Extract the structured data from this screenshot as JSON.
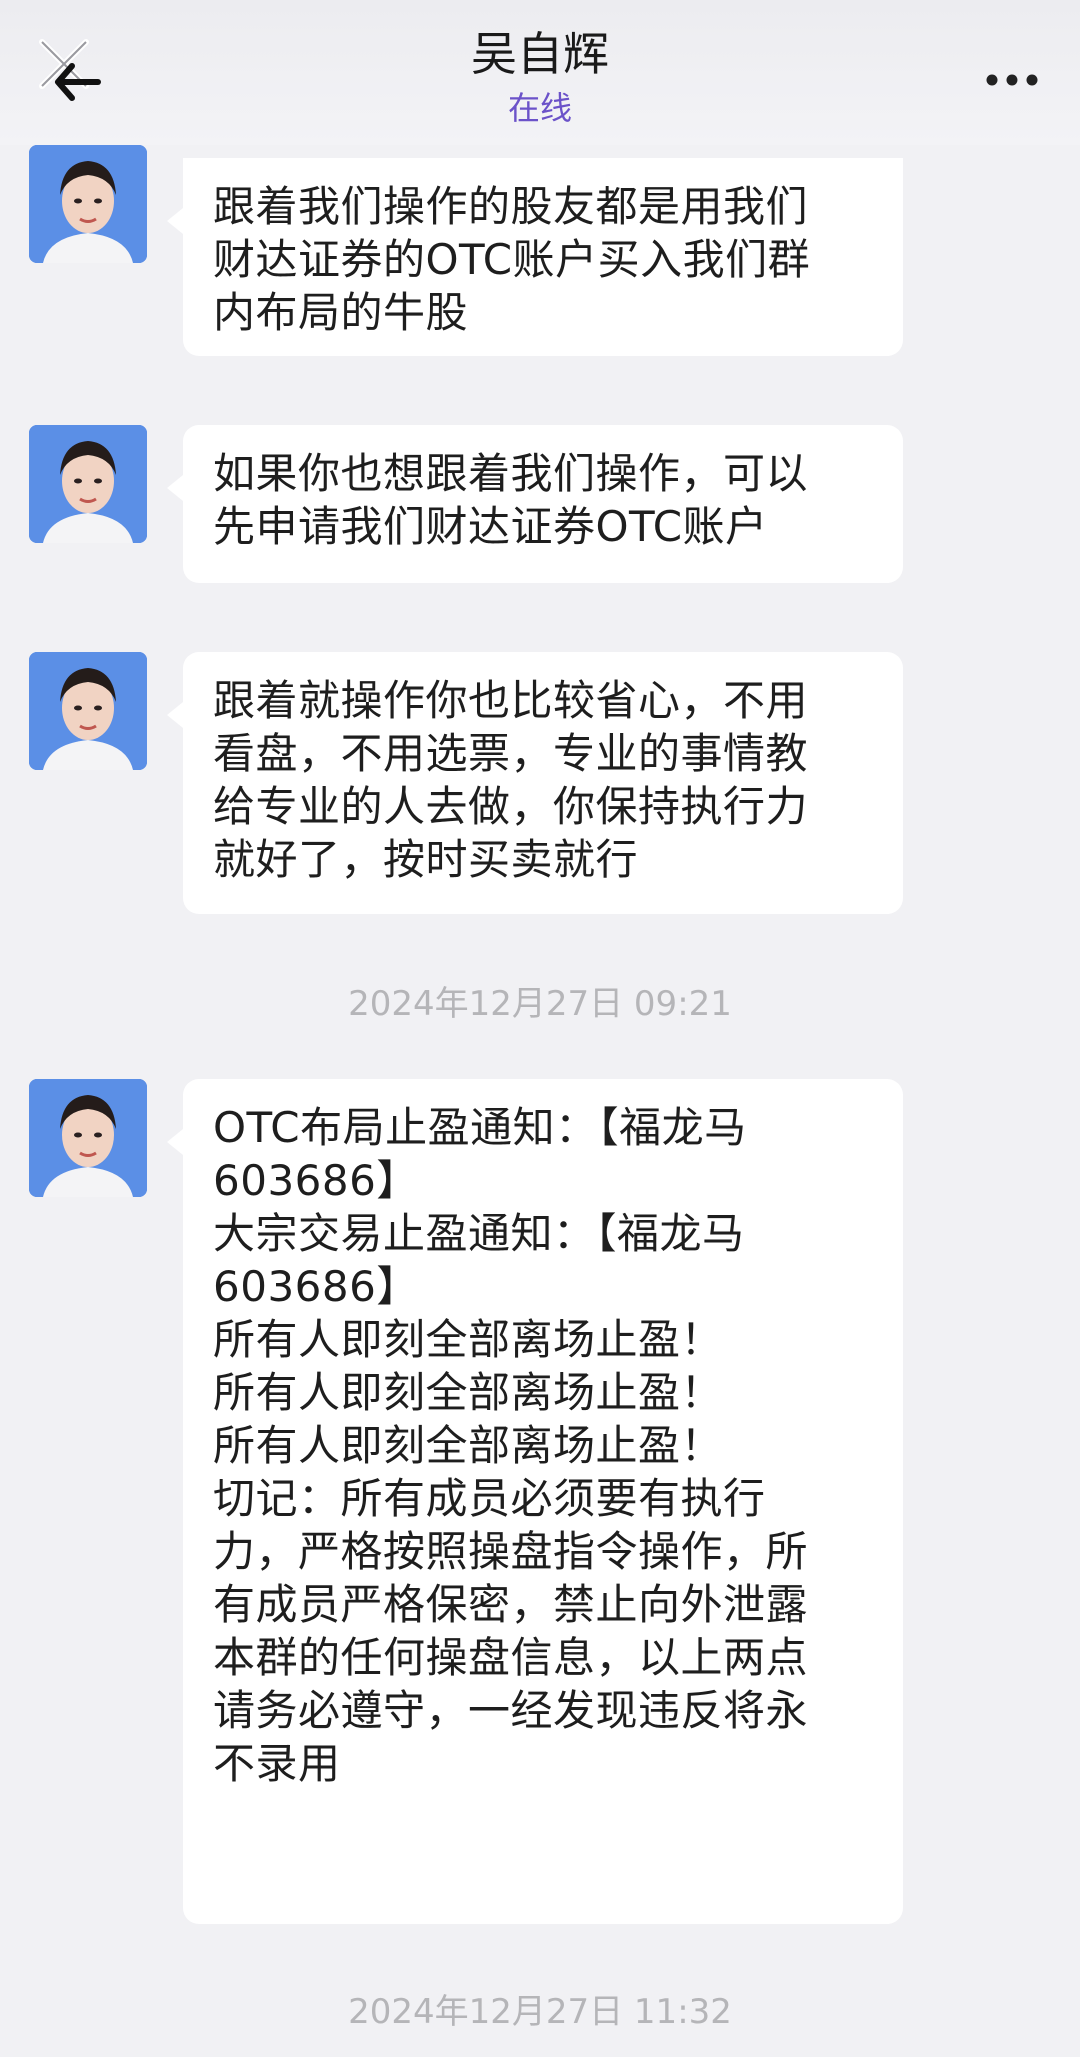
{
  "header": {
    "title": "吴自辉",
    "status": "在线"
  },
  "messages": [
    {
      "lines": [
        "跟着我们操作的股友都是用我们",
        "财达证券的OTC账户买入我们群",
        "内布局的牛股"
      ]
    },
    {
      "lines": [
        "如果你也想跟着我们操作，可以",
        "先申请我们财达证券OTC账户"
      ]
    },
    {
      "lines": [
        "跟着就操作你也比较省心，不用",
        "看盘，不用选票，专业的事情教",
        "给专业的人去做，你保持执行力",
        "就好了，按时买卖就行"
      ]
    },
    {
      "lines": [
        "OTC布局止盈通知：【福龙马",
        "603686】",
        "大宗交易止盈通知：【福龙马",
        "603686】",
        "所有人即刻全部离场止盈！",
        "所有人即刻全部离场止盈！",
        "所有人即刻全部离场止盈！",
        "切记：所有成员必须要有执行",
        "力，严格按照操盘指令操作，所",
        "有成员严格保密，禁止向外泄露",
        "本群的任何操盘信息，以上两点",
        "请务必遵守，一经发现违反将永",
        "不录用"
      ]
    }
  ],
  "timestamps": [
    "2024年12月27日 09:21",
    "2024年12月27日 11:32"
  ],
  "icons": {
    "close": "close-icon",
    "back": "back-arrow-icon",
    "more": "more-dots-icon",
    "avatar_bg": "#5b8fe6"
  }
}
